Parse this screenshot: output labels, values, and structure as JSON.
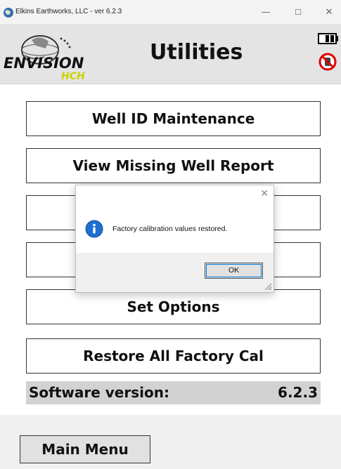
{
  "window": {
    "title": "Elkins Earthworks, LLC - ver 6.2.3",
    "minimize_glyph": "—",
    "maximize_glyph": "☐",
    "close_glyph": "✕"
  },
  "header": {
    "title": "Utilities",
    "logo_text": "ENVISION",
    "logo_subtext": "HCH"
  },
  "menu": {
    "items": [
      {
        "label": "Well ID Maintenance"
      },
      {
        "label": "View Missing Well Report"
      },
      {
        "label": ""
      },
      {
        "label": ""
      },
      {
        "label": "Set Options"
      },
      {
        "label": "Restore All Factory Cal"
      }
    ]
  },
  "version": {
    "label": "Software version:",
    "value": "6.2.3"
  },
  "footer": {
    "main_menu_label": "Main Menu"
  },
  "dialog": {
    "message": "Factory calibration values restored.",
    "ok_label": "OK",
    "close_glyph": "✕"
  },
  "colors": {
    "header_bg": "#e4e4e4",
    "version_bg": "#d2d2d2",
    "logo_green": "#c8d400",
    "info_blue": "#1f6fd1"
  },
  "icons": [
    "app-icon",
    "envision-logo",
    "battery-icon",
    "no-signal-icon",
    "info-icon",
    "resize-grip-icon"
  ]
}
